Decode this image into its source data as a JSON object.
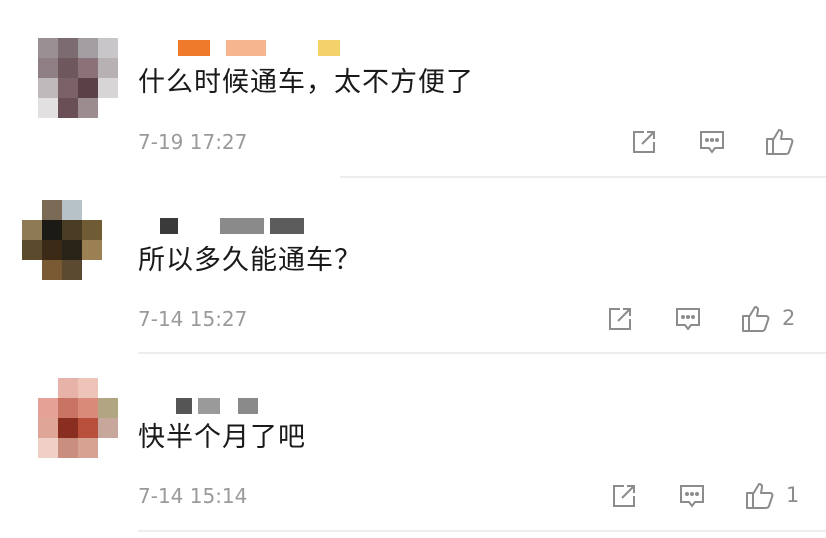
{
  "comments": [
    {
      "text": "什么时候通车，太不方便了",
      "time": "7-19 17:27",
      "likes": "",
      "avatar_colors": [
        "#9a8f92",
        "#7c6b70",
        "#a39ea1",
        "#c9c6c9",
        "#8f7f84",
        "#6e575d",
        "#8b7278",
        "#b7b1b4",
        "#bfb9bc",
        "#7a6268",
        "#5a4148",
        "#d8d5d7",
        "#e2e0e1",
        "#6a5056",
        "#9c8c90",
        "#ffffff"
      ],
      "name_colors": [
        "#f07a2c",
        "#f6b58e",
        "#f5d16a"
      ]
    },
    {
      "text": "所以多久能通车？",
      "time": "7-14 15:27",
      "likes": "2",
      "avatar_colors": [
        "#ffffff",
        "#7b6a56",
        "#b7c1c8",
        "#ffffff",
        "#8e7a54",
        "#1c1a14",
        "#4a3c25",
        "#6f5c34",
        "#5b4a2c",
        "#3a2a16",
        "#2a2418",
        "#9a8052",
        "#ffffff",
        "#7a5a32",
        "#5c4a30",
        "#ffffff"
      ],
      "name_colors": [
        "#3a3a3a",
        "#8a8a8a",
        "#5c5c5c"
      ]
    },
    {
      "text": "快半个月了吧",
      "time": "7-14 15:14",
      "likes": "1",
      "avatar_colors": [
        "#ffffff",
        "#e7b3a8",
        "#eec4b8",
        "#ffffff",
        "#e5a196",
        "#c97463",
        "#d98a78",
        "#b1a582",
        "#dfa596",
        "#8b2e22",
        "#b8503b",
        "#c7a79b",
        "#f0cfc6",
        "#c98e7e",
        "#d6a392",
        "#ffffff"
      ],
      "name_colors": [
        "#555555",
        "#9a9a9a",
        "#8a8a8a"
      ]
    }
  ],
  "icons": {
    "share": "share-icon",
    "reply": "comment-icon",
    "like": "thumbs-up-icon"
  }
}
